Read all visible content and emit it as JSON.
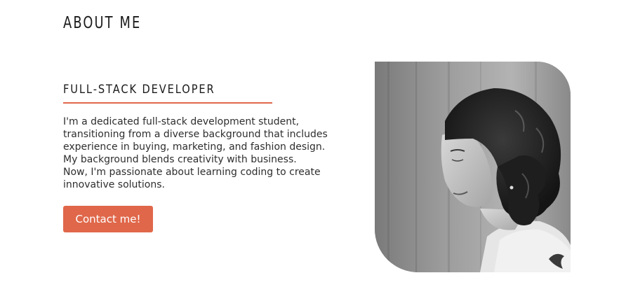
{
  "section": {
    "title": "ABOUT ME"
  },
  "about": {
    "role": "FULL-STACK DEVELOPER",
    "bio_lines": [
      "I'm a dedicated full-stack development student,",
      "transitioning from a diverse background that includes",
      "experience in buying, marketing, and fashion design.",
      "My background blends creativity with business.",
      "Now, I'm passionate about learning coding to create",
      "innovative solutions."
    ],
    "contact_label": "Contact me!"
  },
  "colors": {
    "accent": "#e0674a",
    "text": "#2e2e2e",
    "heading": "#1a1a1a"
  }
}
